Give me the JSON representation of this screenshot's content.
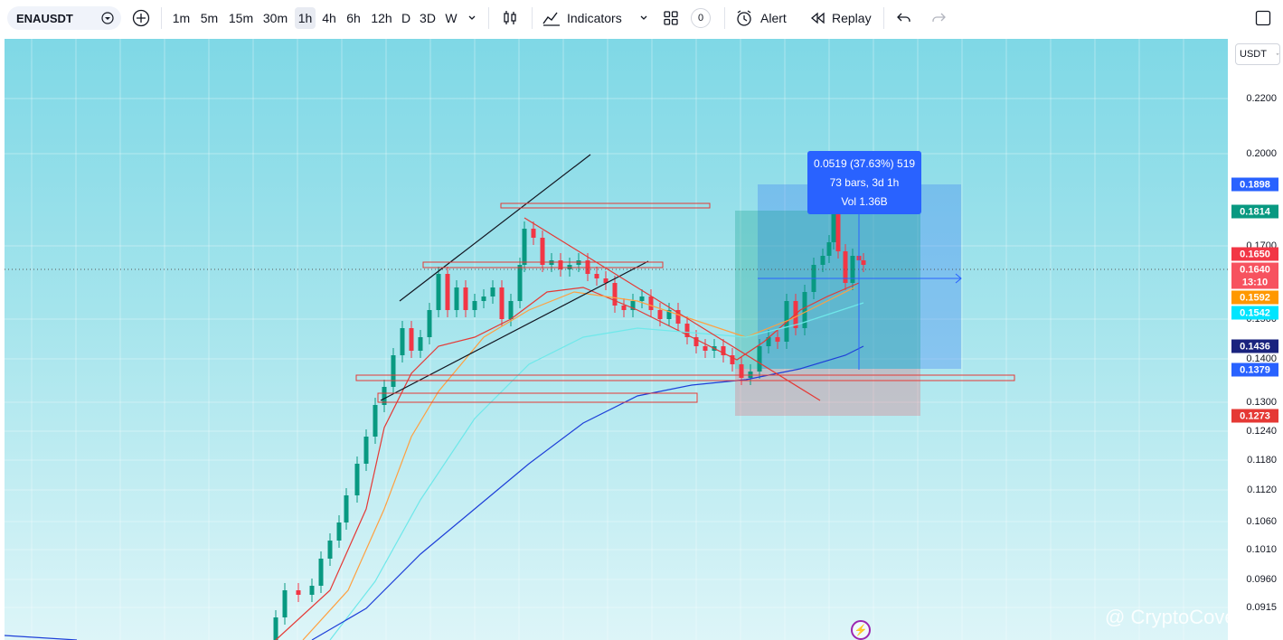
{
  "toolbar": {
    "symbol": "ENAUSDT",
    "intervals": [
      "1m",
      "5m",
      "15m",
      "30m",
      "1h",
      "4h",
      "6h",
      "12h",
      "D",
      "3D",
      "W"
    ],
    "active_interval": "1h",
    "indicators_label": "Indicators",
    "templates_count": "0",
    "alert_label": "Alert",
    "replay_label": "Replay"
  },
  "axis": {
    "currency": "USDT",
    "ticks": [
      "0.2200",
      "0.2000",
      "0.1700",
      "0.1500",
      "0.1400",
      "0.1300",
      "0.1240",
      "0.1180",
      "0.1120",
      "0.1060",
      "0.1010",
      "0.0960",
      "0.0915"
    ],
    "labels": [
      {
        "text": "0.1898",
        "color": "#2962ff"
      },
      {
        "text": "0.1814",
        "color": "#089981"
      },
      {
        "text": "0.1650",
        "color": "#f23645"
      },
      {
        "text": "0.1640",
        "color": "#f7525f"
      },
      {
        "text": "13:10",
        "color": "#f7525f"
      },
      {
        "text": "0.1592",
        "color": "#ff9800"
      },
      {
        "text": "0.1542",
        "color": "#00e5ff"
      },
      {
        "text": "0.1436",
        "color": "#1a237e"
      },
      {
        "text": "0.1379",
        "color": "#2962ff"
      },
      {
        "text": "0.1273",
        "color": "#e53935"
      }
    ]
  },
  "measure": {
    "line1": "0.0519 (37.63%) 519",
    "line2": "73 bars, 3d 1h",
    "line3": "Vol 1.36B"
  },
  "watermark": "@ CryptoCove",
  "colors": {
    "up": "#089981",
    "down": "#f23645",
    "ma_red": "#e53935",
    "ma_orange": "#ffa040",
    "ma_cyan": "#6fe8ea",
    "ma_blue": "#1e3fd8"
  }
}
